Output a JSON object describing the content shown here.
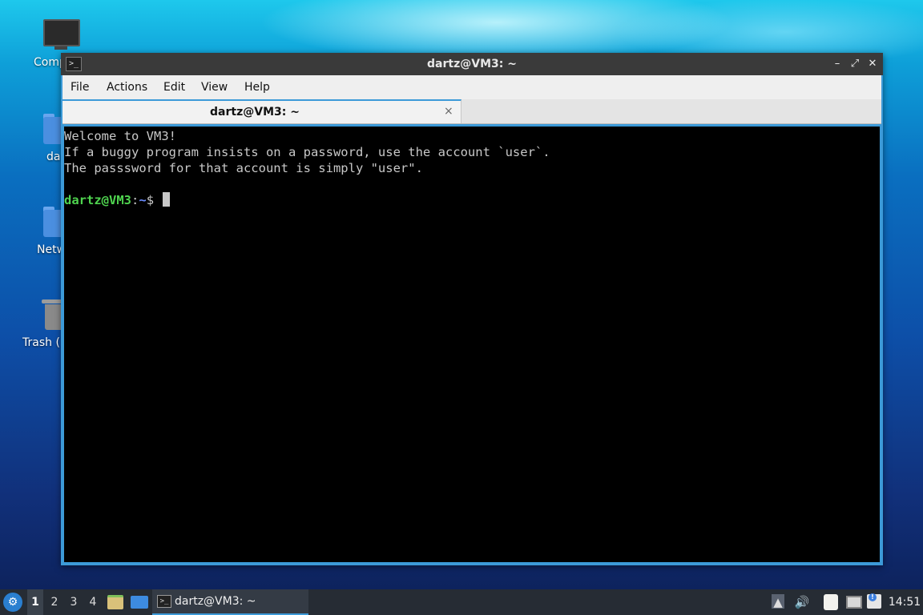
{
  "desktop": {
    "icons": [
      {
        "label": "Comp",
        "icon": "computer-icon"
      },
      {
        "label": "da",
        "icon": "home-folder-icon"
      },
      {
        "label": "Netw",
        "icon": "network-folder-icon"
      },
      {
        "label": "Trash (",
        "icon": "trash-icon"
      }
    ]
  },
  "window": {
    "title": "dartz@VM3: ~",
    "icon_glyph": ">_",
    "controls": {
      "minimize": "–",
      "maximize": "⤢",
      "close": "✕"
    }
  },
  "menu": [
    "File",
    "Actions",
    "Edit",
    "View",
    "Help"
  ],
  "tabs": [
    {
      "label": "dartz@VM3: ~",
      "close_glyph": "×"
    }
  ],
  "terminal": {
    "lines": [
      "Welcome to VM3!",
      "If a buggy program insists on a password, use the account `user`.",
      "The passsword for that account is simply \"user\"."
    ],
    "prompt": {
      "user_host": "dartz@VM3",
      "separator": ":",
      "path": "~",
      "symbol": "$ "
    }
  },
  "taskbar": {
    "start_glyph": "⚙",
    "workspaces": [
      "1",
      "2",
      "3",
      "4"
    ],
    "active_workspace": "1",
    "task": {
      "label": "dartz@VM3: ~",
      "icon_glyph": ">_"
    },
    "tray": {
      "volume_glyph": "🔊",
      "up_glyph": "▲",
      "update_glyph": "!"
    },
    "clock": "14:51"
  },
  "colors": {
    "prompt_user": "#4fd44f",
    "prompt_path": "#6a8cff",
    "accent": "#3c9ad8",
    "taskbar_bg": "#262c34"
  }
}
